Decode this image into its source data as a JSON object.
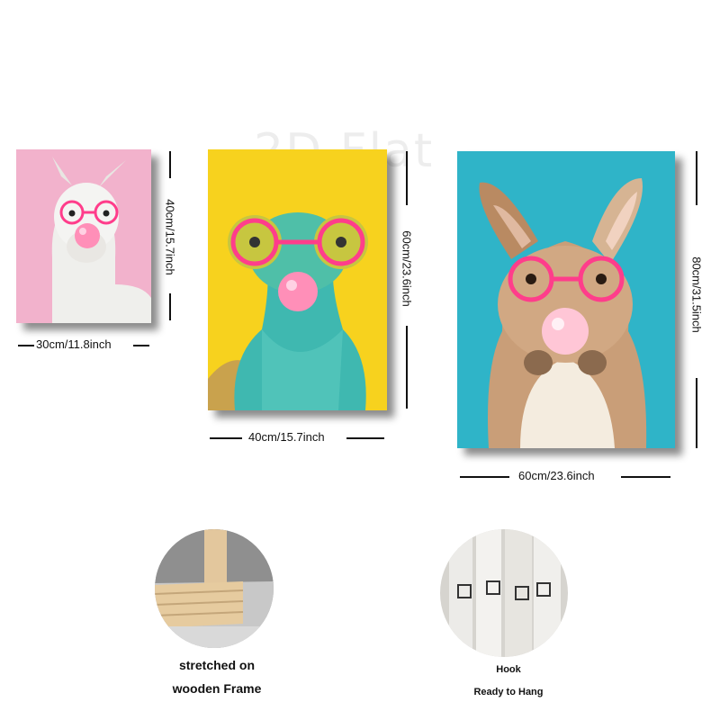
{
  "watermark": "2D Flat",
  "posters": [
    {
      "subject": "llama",
      "width_label": "30cm/11.8inch",
      "height_label": "40cm/15.7inch",
      "bg": "#f0a9c6"
    },
    {
      "subject": "chameleon",
      "width_label": "40cm/15.7inch",
      "height_label": "60cm/23.6inch",
      "bg": "#f7d21e"
    },
    {
      "subject": "rabbit",
      "width_label": "60cm/23.6inch",
      "height_label": "80cm/31.5inch",
      "bg": "#2fb4c8"
    }
  ],
  "features": [
    {
      "line1": "stretched on",
      "line2": "wooden Frame"
    },
    {
      "line1": "Hook",
      "line2": "Ready to Hang"
    }
  ],
  "colors": {
    "glasses": "#ff3d8b",
    "gum": "#ff8fb8"
  }
}
